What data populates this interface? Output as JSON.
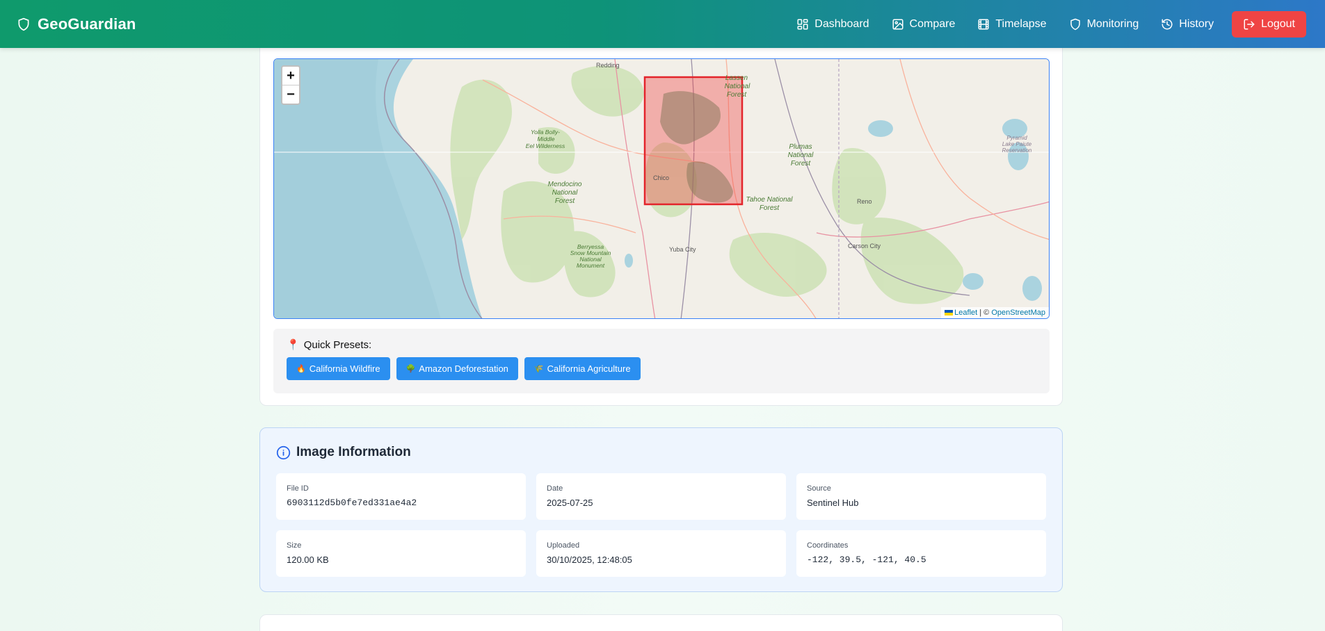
{
  "app": {
    "name": "GeoGuardian"
  },
  "nav": {
    "items": [
      {
        "label": "Dashboard",
        "icon": "dashboard-icon"
      },
      {
        "label": "Compare",
        "icon": "image-icon"
      },
      {
        "label": "Timelapse",
        "icon": "film-icon"
      },
      {
        "label": "Monitoring",
        "icon": "shield-icon"
      },
      {
        "label": "History",
        "icon": "history-icon"
      }
    ],
    "logout_label": "Logout"
  },
  "map": {
    "zoom_in": "+",
    "zoom_out": "−",
    "attribution_leaflet": "Leaflet",
    "attribution_sep": "| ©",
    "attribution_osm": "OpenStreetMap",
    "labels": {
      "redding": "Redding",
      "lassen1": "Lassen",
      "lassen2": "National",
      "lassen3": "Forest",
      "yolla1": "Yolla Bolly-",
      "yolla2": "Middle",
      "yolla3": "Eel Wilderness",
      "plumas1": "Plumas",
      "plumas2": "National",
      "plumas3": "Forest",
      "pyramid1": "Pyramid",
      "pyramid2": "Lake Paiute",
      "pyramid3": "Reservation",
      "chico": "Chico",
      "mendo1": "Mendocino",
      "mendo2": "National",
      "mendo3": "Forest",
      "tahoe1": "Tahoe National",
      "tahoe2": "Forest",
      "reno": "Reno",
      "berry1": "Berryessa",
      "berry2": "Snow Mountain",
      "berry3": "National",
      "berry4": "Monument",
      "yuba": "Yuba City",
      "carson": "Carson City"
    },
    "selection_color": "#ef4444"
  },
  "presets": {
    "title": "Quick Presets:",
    "pin_icon": "📍",
    "buttons": [
      {
        "label": "California Wildfire",
        "emoji": "🔥"
      },
      {
        "label": "Amazon Deforestation",
        "emoji": "🌳"
      },
      {
        "label": "California Agriculture",
        "emoji": "🌾"
      }
    ]
  },
  "info": {
    "title": "Image Information",
    "fields": [
      {
        "label": "File ID",
        "value": "6903112d5b0fe7ed331ae4a2"
      },
      {
        "label": "Date",
        "value": "2025-07-25"
      },
      {
        "label": "Source",
        "value": "Sentinel Hub"
      },
      {
        "label": "Size",
        "value": "120.00 KB"
      },
      {
        "label": "Uploaded",
        "value": "30/10/2025, 12:48:05"
      },
      {
        "label": "Coordinates",
        "value": "-122, 39.5, -121, 40.5"
      }
    ]
  }
}
